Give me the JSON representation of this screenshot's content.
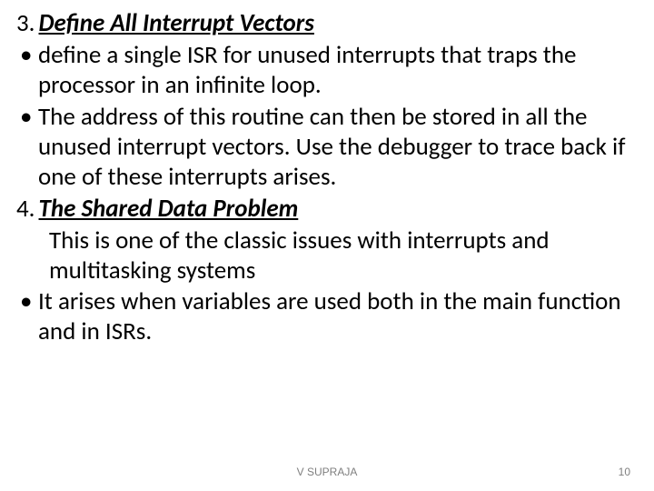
{
  "heading1": {
    "num": "3.",
    "text": "Define All Interrupt Vectors"
  },
  "bullets1": [
    "define a single ISR for unused interrupts that traps the processor in an infinite loop.",
    "The address of this routine can then be stored in all the unused interrupt vectors. Use the debugger to trace back if one of these interrupts arises."
  ],
  "heading2": {
    "num": "4.",
    "text": "The Shared Data Problem"
  },
  "indent2": "This is one of the classic issues with interrupts and multitasking systems",
  "bullets2": [
    "It arises when variables are used both in the main function and in ISRs."
  ],
  "footer": {
    "author": "V SUPRAJA",
    "page": "10"
  }
}
